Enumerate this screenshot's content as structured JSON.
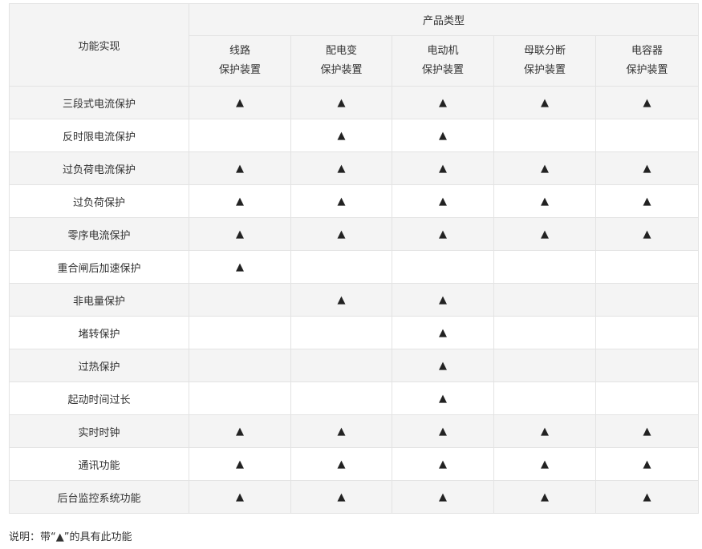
{
  "table": {
    "corner_header": "功能实现",
    "group_header": "产品类型",
    "columns": [
      {
        "line1": "线路",
        "line2": "保护装置"
      },
      {
        "line1": "配电变",
        "line2": "保护装置"
      },
      {
        "line1": "电动机",
        "line2": "保护装置"
      },
      {
        "line1": "母联分断",
        "line2": "保护装置"
      },
      {
        "line1": "电容器",
        "line2": "保护装置"
      }
    ],
    "rows": [
      {
        "label": "三段式电流保护",
        "cells": [
          "▲",
          "▲",
          "▲",
          "▲",
          "▲"
        ]
      },
      {
        "label": "反时限电流保护",
        "cells": [
          "",
          "▲",
          "▲",
          "",
          ""
        ]
      },
      {
        "label": "过负荷电流保护",
        "cells": [
          "▲",
          "▲",
          "▲",
          "▲",
          "▲"
        ]
      },
      {
        "label": "过负荷保护",
        "cells": [
          "▲",
          "▲",
          "▲",
          "▲",
          "▲"
        ]
      },
      {
        "label": "零序电流保护",
        "cells": [
          "▲",
          "▲",
          "▲",
          "▲",
          "▲"
        ]
      },
      {
        "label": "重合闸后加速保护",
        "cells": [
          "▲",
          "",
          "",
          "",
          ""
        ]
      },
      {
        "label": "非电量保护",
        "cells": [
          "",
          "▲",
          "▲",
          "",
          ""
        ]
      },
      {
        "label": "堵转保护",
        "cells": [
          "",
          "",
          "▲",
          "",
          ""
        ]
      },
      {
        "label": "过热保护",
        "cells": [
          "",
          "",
          "▲",
          "",
          ""
        ]
      },
      {
        "label": "起动时间过长",
        "cells": [
          "",
          "",
          "▲",
          "",
          ""
        ]
      },
      {
        "label": "实时时钟",
        "cells": [
          "▲",
          "▲",
          "▲",
          "▲",
          "▲"
        ]
      },
      {
        "label": "通讯功能",
        "cells": [
          "▲",
          "▲",
          "▲",
          "▲",
          "▲"
        ]
      },
      {
        "label": "后台监控系统功能",
        "cells": [
          "▲",
          "▲",
          "▲",
          "▲",
          "▲"
        ]
      }
    ]
  },
  "note": "说明：带“▲”的具有此功能",
  "colors": {
    "border": "#e3e3e3",
    "stripe": "#f4f4f4",
    "text": "#333333"
  }
}
